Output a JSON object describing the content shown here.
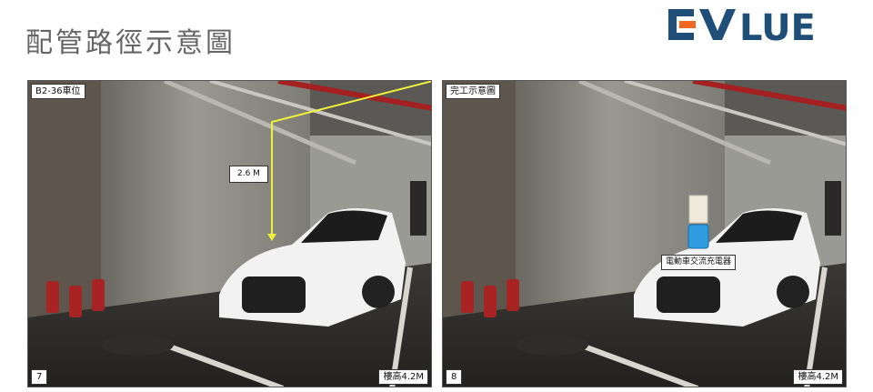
{
  "title": "配管路徑示意圖",
  "logo": {
    "text": "EVALUE",
    "text_color": "#1f4e79",
    "accent_color": "#f26722"
  },
  "left_photo": {
    "caption": "B2-36車位",
    "measure_label": "2.6 M",
    "page_number": "7",
    "height_label": "樓高4.2M",
    "route_color": "#f2f23a"
  },
  "right_photo": {
    "caption": "完工示意圖",
    "device_label": "電動車交流充電器",
    "page_number": "8",
    "height_label": "樓高4.2M",
    "charger_color": "#2f9be0"
  }
}
